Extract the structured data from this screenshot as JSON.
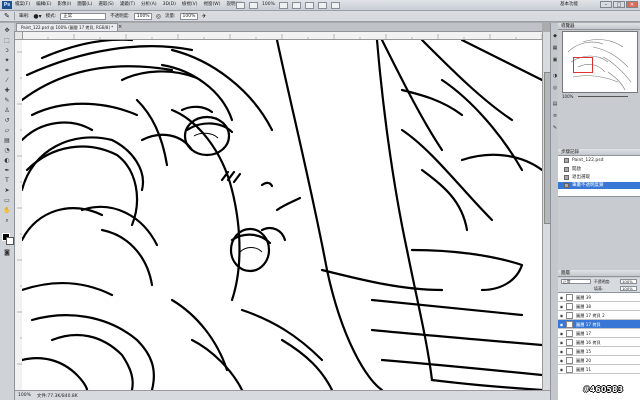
{
  "menubar": {
    "logo": "Ps",
    "items": [
      "檔案(F)",
      "編輯(E)",
      "影像(I)",
      "圖層(L)",
      "選取(S)",
      "濾鏡(T)",
      "分析(A)",
      "3D(D)",
      "檢視(V)",
      "視窗(W)",
      "說明(H)"
    ],
    "zoom": "100%",
    "workspace": "基本功能",
    "window_buttons": [
      "–",
      "□",
      "✕"
    ]
  },
  "options_bar": {
    "brush_label": "筆刷:",
    "mode_label": "模式:",
    "mode_value": "正常",
    "opacity_label": "不透明度:",
    "opacity_value": "100%",
    "flow_label": "流量:",
    "flow_value": "100%"
  },
  "document_tab": {
    "title": "Paint_122.psd @ 100% (圖層 17 拷貝, RGB/8) *",
    "close": "×"
  },
  "status_bar": {
    "zoom": "100%",
    "doc_info": "文件:77.3K/840.8K"
  },
  "panels": {
    "navigator_title": "導覽器",
    "navigator_zoom": "100%",
    "history_title": "步驟記錄",
    "history_items": [
      {
        "label": "Paint_122.psd",
        "selected": false
      },
      {
        "label": "開啟",
        "selected": false
      },
      {
        "label": "退出選取",
        "selected": false
      },
      {
        "label": "筆畫不透明度鎖",
        "selected": true
      }
    ],
    "layers_title": "圖層",
    "blend_mode": "正常",
    "opacity_label": "不透明度:",
    "opacity_value": "100%",
    "fill_label": "填滿:",
    "fill_value": "100%",
    "layers": [
      {
        "name": "圖層 39",
        "selected": false
      },
      {
        "name": "圖層 38",
        "selected": false
      },
      {
        "name": "圖層 17 拷貝 2",
        "selected": false
      },
      {
        "name": "圖層 17 拷貝",
        "selected": true
      },
      {
        "name": "圖層 17",
        "selected": false
      },
      {
        "name": "圖層 16 拷貝",
        "selected": false
      },
      {
        "name": "圖層 15",
        "selected": false
      },
      {
        "name": "圖層 20",
        "selected": false
      },
      {
        "name": "圖層 11",
        "selected": false
      }
    ]
  },
  "watermark": "#460583",
  "colors": {
    "selection": "#3877d6",
    "chrome": "#d7dbe0",
    "canvas": "#ffffff",
    "line_art": "#000000"
  }
}
